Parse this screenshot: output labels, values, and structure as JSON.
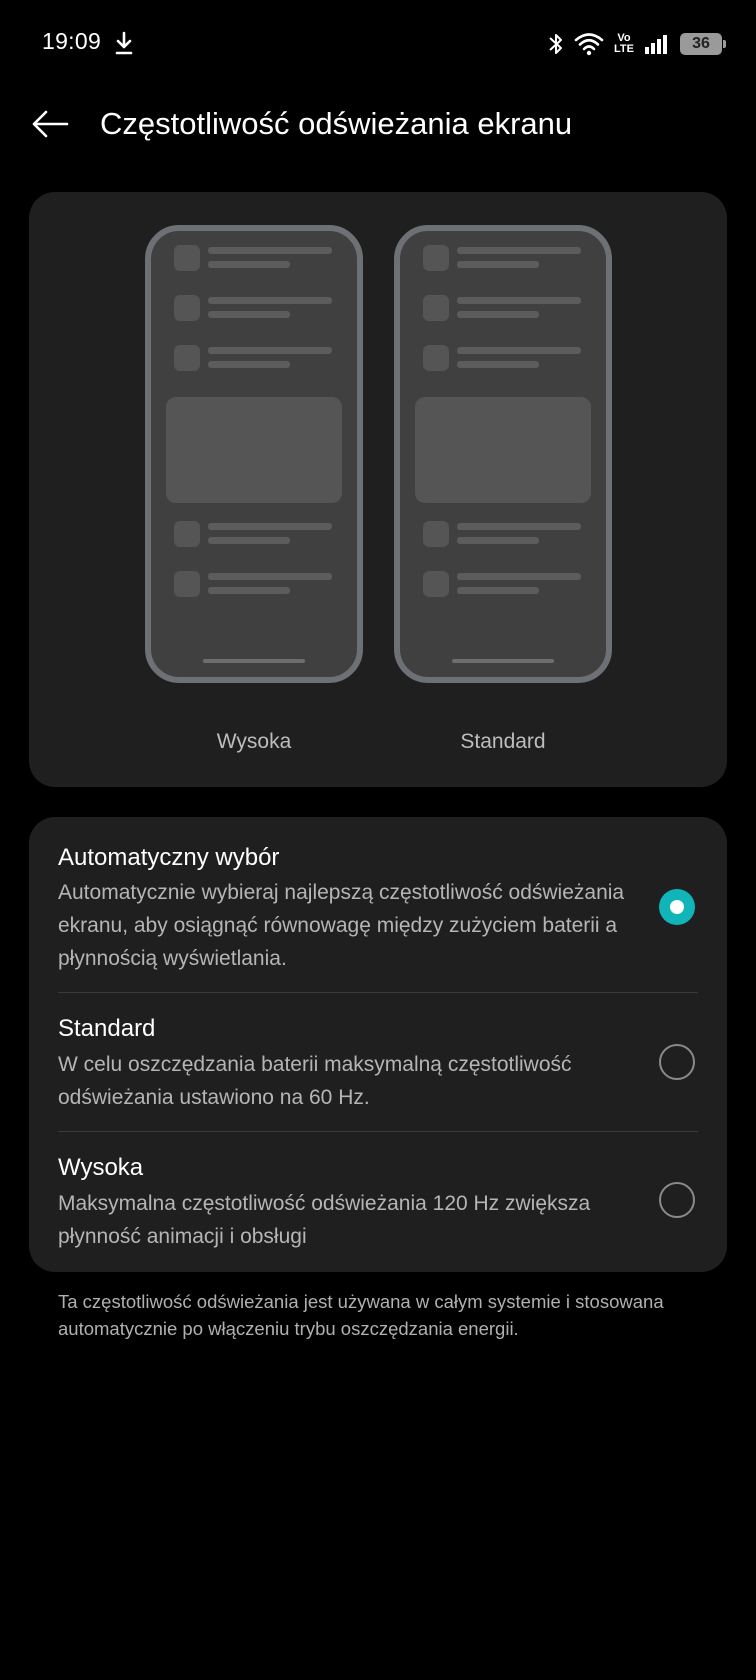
{
  "status_bar": {
    "time": "19:09",
    "battery": "36",
    "icons": [
      "download-icon",
      "bluetooth-icon",
      "wifi-icon",
      "volte-icon",
      "signal-icon",
      "battery-icon"
    ],
    "volte_label_top": "Vo",
    "volte_label_bottom": "LTE"
  },
  "header": {
    "title": "Częstotliwość odświeżania ekranu",
    "back_icon": "arrow-left-icon"
  },
  "preview": {
    "high_label": "Wysoka",
    "standard_label": "Standard"
  },
  "options": [
    {
      "title": "Automatyczny wybór",
      "description": "Automatycznie wybieraj najlepszą częstotliwość odświeżania ekranu, aby osiągnąć równowagę między zużyciem baterii a płynnością wyświetlania.",
      "selected": true
    },
    {
      "title": "Standard",
      "description": "W celu oszczędzania baterii maksymalną częstotliwość odświeżania ustawiono na 60 Hz.",
      "selected": false
    },
    {
      "title": "Wysoka",
      "description": "Maksymalna częstotliwość odświeżania 120 Hz zwiększa płynność animacji i obsługi",
      "selected": false
    }
  ],
  "footnote": "Ta częstotliwość odświeżania jest używana w całym systemie i stosowana automatycznie po włączeniu trybu oszczędzania energii.",
  "colors": {
    "background": "#000000",
    "card": "#1f1f1f",
    "accent": "#10b5ba",
    "secondary_text": "#b5b5b5"
  }
}
